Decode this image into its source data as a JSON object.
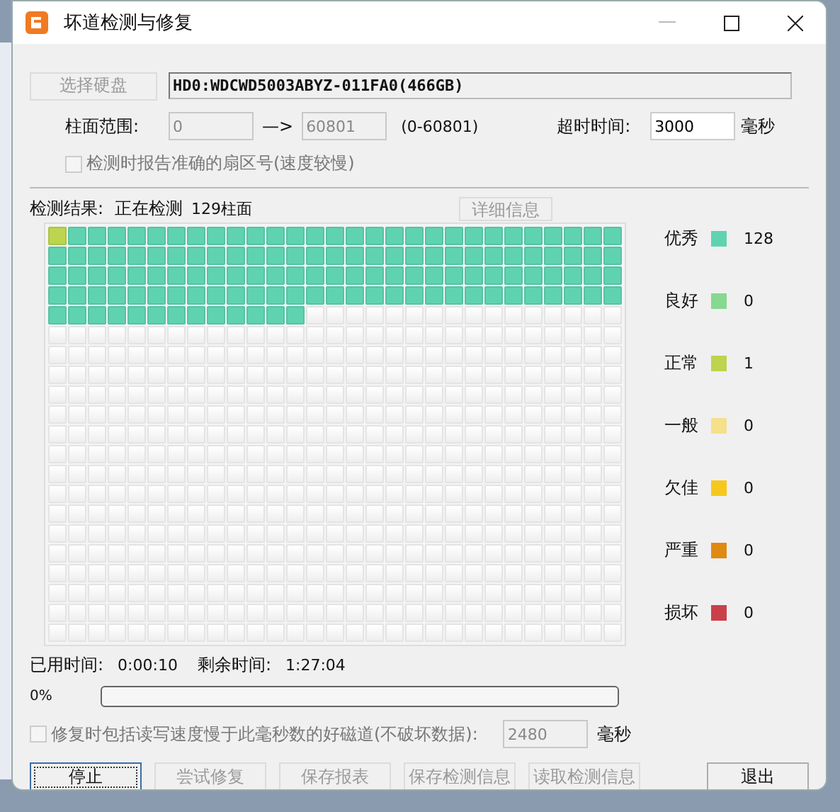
{
  "window": {
    "title": "坏道检测与修复"
  },
  "disk": {
    "button": {
      "label": "选择硬盘",
      "disabled": true
    },
    "value": "HD0:WDCWD5003ABYZ-011FA0(466GB)"
  },
  "range": {
    "label": "柱面范围:",
    "from": {
      "value": "0",
      "disabled": true
    },
    "arrow": "—>",
    "to": {
      "value": "60801",
      "disabled": true
    },
    "hint": "(0-60801)"
  },
  "timeout": {
    "label": "超时时间:",
    "value": "3000",
    "unit": "毫秒"
  },
  "report_option": {
    "label": "检测时报告准确的扇区号(速度较慢)",
    "checked": false,
    "disabled": true
  },
  "result": {
    "label": "检测结果:",
    "status": "正在检测",
    "cylinders": "129柱面",
    "detail_button": {
      "label": "详细信息",
      "disabled": true
    }
  },
  "grid": {
    "runs": [
      {
        "kind": "normal"
      },
      {
        "kind": "excellent"
      }
    ]
  },
  "legend": [
    {
      "kind": "excellent",
      "label": "优秀",
      "color": "#5fd3b0",
      "count": "128"
    },
    {
      "kind": "good",
      "label": "良好",
      "color": "#86d98f",
      "count": "0"
    },
    {
      "kind": "normal",
      "label": "正常",
      "color": "#bcd44e",
      "count": "1"
    },
    {
      "kind": "fair",
      "label": "一般",
      "color": "#f5e08c",
      "count": "0"
    },
    {
      "kind": "poor",
      "label": "欠佳",
      "color": "#f7c81c",
      "count": "0"
    },
    {
      "kind": "serious",
      "label": "严重",
      "color": "#e08a12",
      "count": "0"
    },
    {
      "kind": "damaged",
      "label": "损坏",
      "color": "#c9404a",
      "count": "0"
    }
  ],
  "time": {
    "elapsed_label": "已用时间:",
    "elapsed": "0:00:10",
    "remaining_label": "剩余时间:",
    "remaining": "1:27:04"
  },
  "progress": {
    "reading": "0%",
    "level": 0
  },
  "repair_option": {
    "label": "修复时包括读写速度慢于此毫秒数的好磁道(不破坏数据):",
    "checked": false,
    "disabled": true,
    "value": "2480",
    "unit": "毫秒"
  },
  "buttons": [
    {
      "label": "停止",
      "disabled": false,
      "focused": true
    },
    {
      "label": "尝试修复",
      "disabled": true,
      "focused": false
    },
    {
      "label": "保存报表",
      "disabled": true,
      "focused": false
    },
    {
      "label": "保存检测信息",
      "disabled": true,
      "focused": false
    },
    {
      "label": "读取检测信息",
      "disabled": true,
      "focused": false
    },
    {
      "label": "退出",
      "disabled": false,
      "focused": false
    }
  ]
}
